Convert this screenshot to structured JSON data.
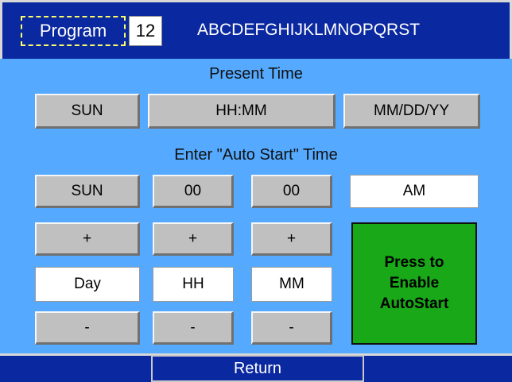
{
  "header": {
    "program_label": "Program",
    "program_number": "12",
    "program_name": "ABCDEFGHIJKLMNOPQRST"
  },
  "present": {
    "title": "Present Time",
    "day": "SUN",
    "time": "HH:MM",
    "date": "MM/DD/YY"
  },
  "autostart": {
    "title": "Enter \"Auto Start\" Time",
    "day_value": "SUN",
    "hour_value": "00",
    "minute_value": "00",
    "ampm": "AM",
    "plus": "+",
    "minus": "-",
    "day_label": "Day",
    "hour_label": "HH",
    "minute_label": "MM",
    "enable_label": "Press to\nEnable\nAutoStart"
  },
  "footer": {
    "return_label": "Return"
  },
  "colors": {
    "background": "#55aaff",
    "bar": "#0a28a0",
    "button": "#c0c0c0",
    "enable": "#18a818"
  }
}
